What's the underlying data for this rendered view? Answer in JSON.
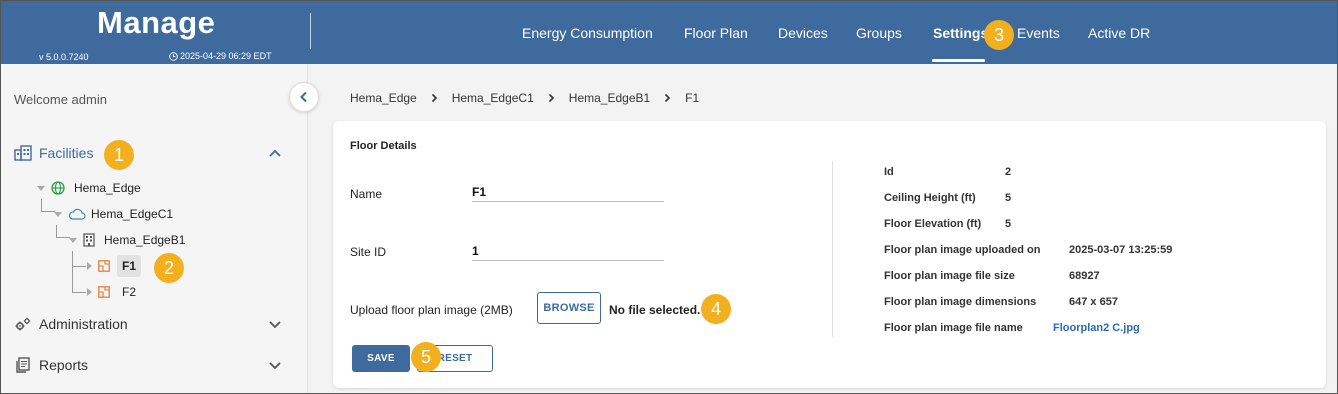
{
  "header": {
    "brand": "Manage",
    "version": "v 5.0.0.7240",
    "datetime": "2025-04-29 06:29 EDT",
    "nav": [
      {
        "label": "Energy Consumption"
      },
      {
        "label": "Floor Plan"
      },
      {
        "label": "Devices"
      },
      {
        "label": "Groups"
      },
      {
        "label": "Settings",
        "active": true
      },
      {
        "label": "Events"
      },
      {
        "label": "Active DR"
      }
    ]
  },
  "callouts": [
    "1",
    "2",
    "3",
    "4",
    "5"
  ],
  "sidebar": {
    "welcome": "Welcome admin",
    "sections": [
      {
        "label": "Facilities",
        "icon": "building-icon",
        "expanded": true
      },
      {
        "label": "Administration",
        "icon": "gears-icon",
        "expanded": false
      },
      {
        "label": "Reports",
        "icon": "report-icon",
        "expanded": false
      }
    ],
    "tree": [
      {
        "label": "Hema_Edge",
        "icon": "globe-icon"
      },
      {
        "label": "Hema_EdgeC1",
        "icon": "cloud-icon"
      },
      {
        "label": "Hema_EdgeB1",
        "icon": "building-icon"
      },
      {
        "label": "F1",
        "icon": "floor-icon",
        "selected": true
      },
      {
        "label": "F2",
        "icon": "floor-icon"
      }
    ]
  },
  "breadcrumb": [
    "Hema_Edge",
    "Hema_EdgeC1",
    "Hema_EdgeB1",
    "F1"
  ],
  "floor_details": {
    "title": "Floor Details",
    "name_label": "Name",
    "name_value": "F1",
    "site_id_label": "Site ID",
    "site_id_value": "1",
    "upload_label": "Upload floor plan image (2MB)",
    "browse_label": "BROWSE",
    "file_status": "No file selected.",
    "save_label": "SAVE",
    "reset_label": "RESET"
  },
  "info": [
    {
      "label": "Id",
      "value": "2"
    },
    {
      "label": "Ceiling Height (ft)",
      "value": "5"
    },
    {
      "label": "Floor Elevation (ft)",
      "value": "5"
    },
    {
      "label": "Floor plan image uploaded on",
      "value": "2025-03-07 13:25:59"
    },
    {
      "label": "Floor plan image file size",
      "value": "68927"
    },
    {
      "label": "Floor plan image dimensions",
      "value": "647 x 657"
    },
    {
      "label": "Floor plan image file name",
      "value": "Floorplan2 C.jpg",
      "link": true
    }
  ],
  "colors": {
    "header_bg": "#3e6a9d",
    "accent": "#3e6a9d",
    "callout": "#f2b01e",
    "link": "#2a6bb8"
  }
}
